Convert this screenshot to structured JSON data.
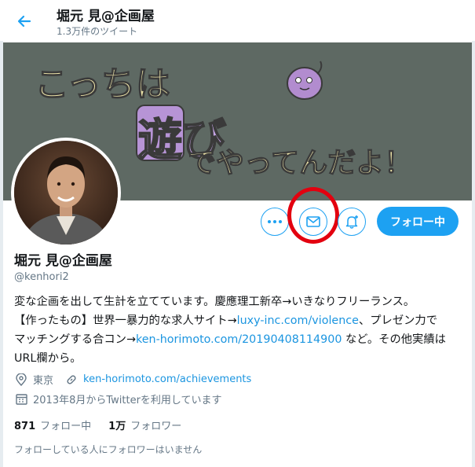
{
  "header": {
    "title": "堀元 見@企画屋",
    "tweet_count": "1.3万件のツイート"
  },
  "banner": {
    "line1": "こっちは",
    "line2": "遊び",
    "line3": "でやってんだよ！"
  },
  "actions": {
    "follow_label": "フォロー中"
  },
  "profile": {
    "name": "堀元 見@企画屋",
    "handle": "@kenhori2",
    "bio": {
      "l1": "変な企画を出して生計を立てています。慶應理工新卒→いきなりフリーランス。",
      "l2a": "【作ったもの】世界一暴力的な求人サイト→",
      "l2link": "luxy-inc.com/violence",
      "l2b": "、プレゼン力で",
      "l3a": "マッチングする合コン→",
      "l3link": "ken-horimoto.com/20190408114900",
      "l3b": " など。その他実績は",
      "l4": "URL欄から。"
    },
    "location": "東京",
    "website": "ken-horimoto.com/achievements",
    "joined": "2013年8月からTwitterを利用しています",
    "following_count": "871",
    "following_label": "フォロー中",
    "followers_count": "1万",
    "followers_label": "フォロワー",
    "known_followers": "フォローしている人にフォロワーはいません"
  },
  "colors": {
    "accent": "#1da1f2",
    "link": "#1b95e0",
    "banner_bg": "#5e6963",
    "highlight_ring": "#e3000f"
  }
}
